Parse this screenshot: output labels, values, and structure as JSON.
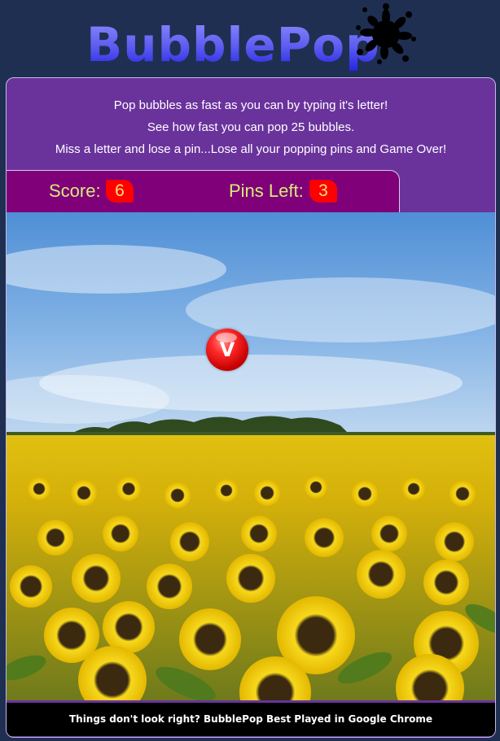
{
  "header": {
    "logo_text": "BubblePop",
    "splat_icon": "ink-splat-icon"
  },
  "instructions": {
    "lines": [
      "Pop bubbles as fast as you can by typing it's letter!",
      "See how fast you can pop 25 bubbles.",
      "Miss a letter and lose a pin...Lose all your popping pins and Game Over!"
    ]
  },
  "scoreboard": {
    "score_label": "Score:",
    "score_value": "6",
    "pins_label": "Pins Left:",
    "pins_value": "3"
  },
  "game": {
    "bubble_letter": "V",
    "background": "sunflower-field-sky"
  },
  "footer": {
    "text": "Things don't look right? BubblePop Best Played in Google Chrome"
  },
  "colors": {
    "page_bg": "#1f2f52",
    "card_bg": "#6a339c",
    "scorebar_bg": "#7f0079",
    "label_color": "#d8ea7a",
    "value_bg": "#ff0000",
    "bubble": "#e00000"
  }
}
